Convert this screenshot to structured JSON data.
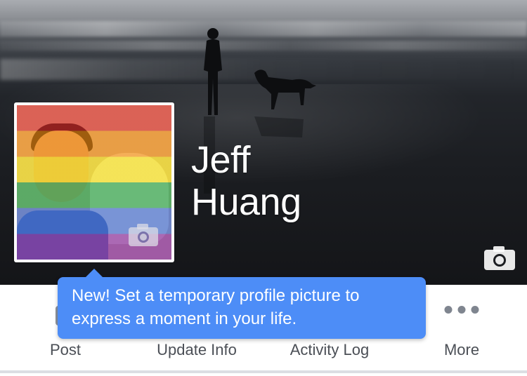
{
  "profile": {
    "first_name": "Jeff",
    "last_name": "Huang",
    "cover_camera_icon": "camera-icon",
    "avatar_camera_icon": "camera-icon",
    "avatar_overlay": "rainbow-flag-filter"
  },
  "tooltip": {
    "text": "New! Set a temporary profile picture to express a moment in your life.",
    "color": "#4d8df7"
  },
  "actions": [
    {
      "label": "Post",
      "icon": "compose-icon"
    },
    {
      "label": "Update Info",
      "icon": ""
    },
    {
      "label": "Activity Log",
      "icon": ""
    },
    {
      "label": "More",
      "icon": "more-dots-icon"
    }
  ],
  "colors": {
    "tooltip_bg": "#4d8df7",
    "action_label": "#4b4f56",
    "icon_gray": "#7f858f"
  }
}
